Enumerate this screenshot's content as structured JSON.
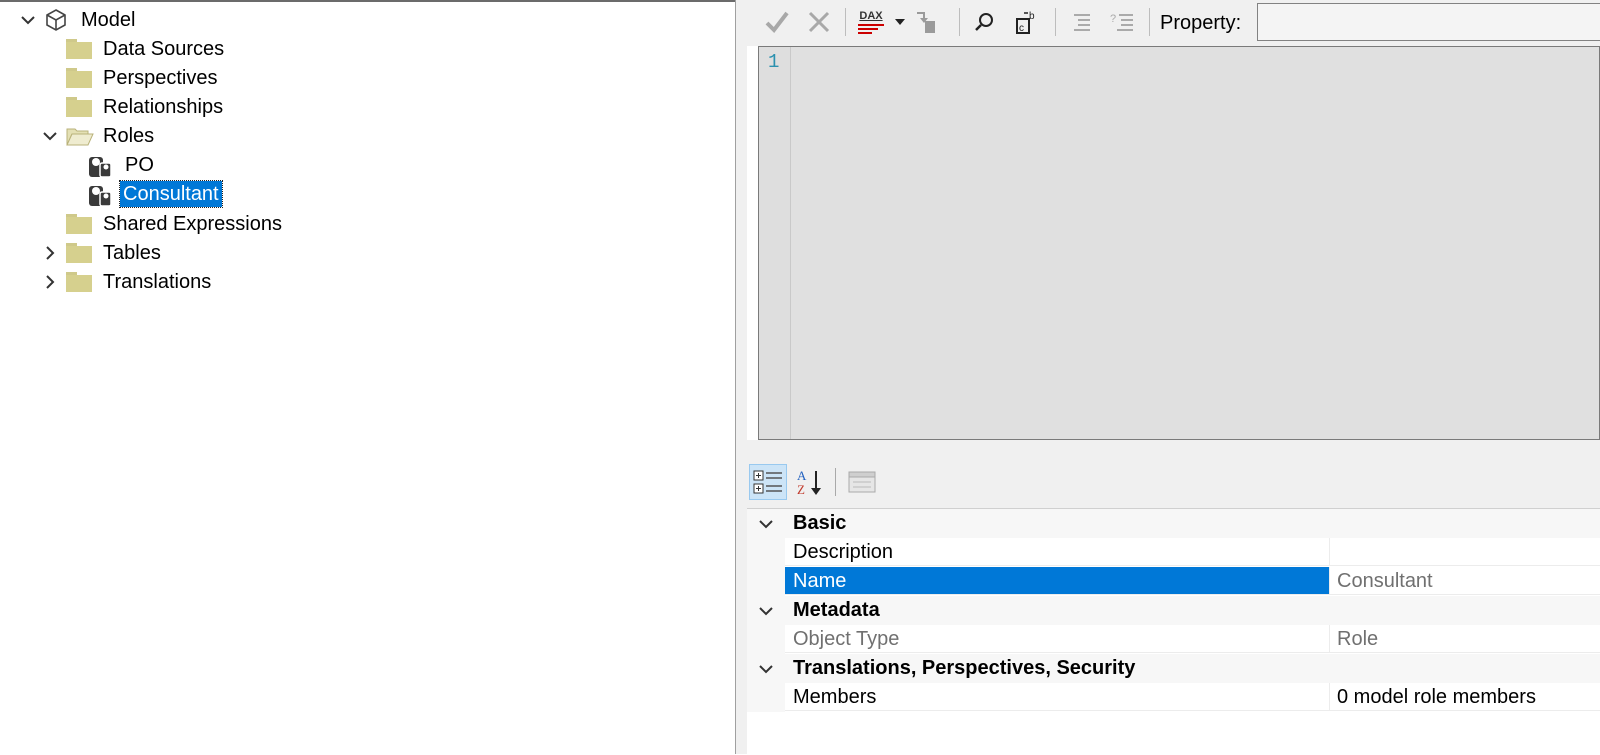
{
  "tree": {
    "root": {
      "label": "Model",
      "icon": "cube-icon"
    },
    "items": [
      {
        "label": "Data Sources",
        "icon": "folder-icon"
      },
      {
        "label": "Perspectives",
        "icon": "folder-icon"
      },
      {
        "label": "Relationships",
        "icon": "folder-icon"
      },
      {
        "label": "Roles",
        "icon": "folder-open-icon",
        "expanded": true,
        "children": [
          {
            "label": "PO",
            "icon": "role-icon"
          },
          {
            "label": "Consultant",
            "icon": "role-icon",
            "selected": true
          }
        ]
      },
      {
        "label": "Shared Expressions",
        "icon": "folder-icon"
      },
      {
        "label": "Tables",
        "icon": "folder-icon",
        "collapsed": true
      },
      {
        "label": "Translations",
        "icon": "folder-icon",
        "collapsed": true
      }
    ]
  },
  "toolbar": {
    "property_label": "Property:",
    "property_value": "",
    "dax_label": "DAX"
  },
  "editor": {
    "line_number": "1",
    "content": ""
  },
  "properties": {
    "categories": [
      {
        "label": "Basic",
        "rows": [
          {
            "name": "Description",
            "value": ""
          },
          {
            "name": "Name",
            "value": "Consultant",
            "selected": true
          }
        ]
      },
      {
        "label": "Metadata",
        "rows": [
          {
            "name": "Object Type",
            "value": "Role",
            "readonly": true
          }
        ]
      },
      {
        "label": "Translations, Perspectives, Security",
        "rows": [
          {
            "name": "Members",
            "value": "0 model role members"
          }
        ]
      }
    ]
  },
  "colors": {
    "selection": "#0078d7",
    "folder": "#d6d08e",
    "editor_bg": "#e0e0e0",
    "line_number": "#2b91af"
  }
}
